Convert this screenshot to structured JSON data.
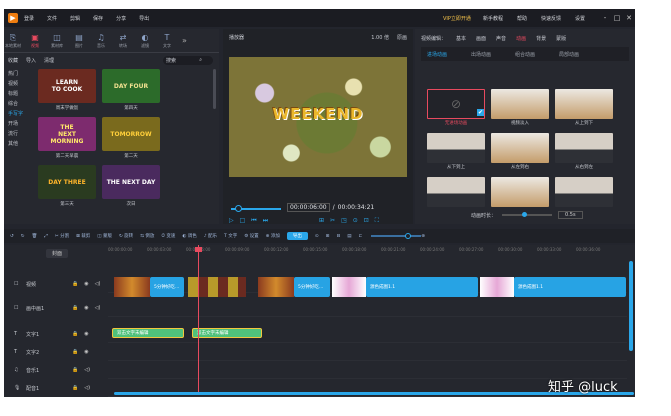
{
  "titlebar": {
    "menu": [
      "登录",
      "文件",
      "剪辑",
      "保存",
      "分享",
      "导出"
    ],
    "vip": "VIP立即开通",
    "right_links": [
      "新手教程",
      "帮助",
      "快速反馈",
      "设置"
    ],
    "window_controls": [
      "-",
      "□",
      "✕"
    ]
  },
  "resources": {
    "tabs": [
      {
        "label": "本地素材",
        "icon": "folder-icon",
        "glyph": "⎘"
      },
      {
        "label": "视频",
        "icon": "video-icon",
        "glyph": "▣",
        "active": true
      },
      {
        "label": "素材库",
        "icon": "library-icon",
        "glyph": "◫"
      },
      {
        "label": "图片",
        "icon": "image-icon",
        "glyph": "▤"
      },
      {
        "label": "音乐",
        "icon": "music-icon",
        "glyph": "♫"
      },
      {
        "label": "转场",
        "icon": "transition-icon",
        "glyph": "⇄"
      },
      {
        "label": "滤镜",
        "icon": "filter-icon",
        "glyph": "◐"
      },
      {
        "label": "文字",
        "icon": "text-icon",
        "glyph": "T"
      }
    ],
    "sub": [
      "收藏",
      "导入",
      "清理"
    ],
    "search_placeholder": "搜索",
    "categories": [
      "热门",
      "视频",
      "标题",
      "综合",
      "手写字",
      "开场",
      "流行",
      "其他"
    ],
    "active_category": 4,
    "thumbnails": [
      {
        "thumb_text": "LEARN\nTO COOK",
        "caption": "周末学做饭"
      },
      {
        "thumb_text": "DAY FOUR",
        "caption": "第四天"
      },
      {
        "thumb_text": "THE\nNEXT\nMORNING",
        "caption": "第二天早晨"
      },
      {
        "thumb_text": "TOMORROW",
        "caption": "第二天"
      },
      {
        "thumb_text": "DAY THREE",
        "caption": "第三天"
      },
      {
        "thumb_text": "THE NEXT DAY",
        "caption": "次日"
      }
    ]
  },
  "preview": {
    "label": "播放器",
    "zoom": "1.00 倍",
    "quality": "原画",
    "overlay_title": "WEEKEND",
    "current_time": "00:00:06:00",
    "total_time": "00:00:34:21",
    "controls": [
      "▷",
      "□",
      "⏮",
      "⏭"
    ],
    "tools": [
      "⊞",
      "✂",
      "◳",
      "⊙",
      "⊡",
      "⛶"
    ]
  },
  "editor": {
    "label": "视频编辑：",
    "tabs": [
      "基本",
      "画面",
      "声音",
      "动画",
      "背景",
      "蒙版"
    ],
    "active_tab": 3,
    "subtabs": [
      "进场动画",
      "出场动画",
      "组合动画",
      "局部动画"
    ],
    "active_subtab": 0,
    "animations": [
      {
        "caption": "无进场动画",
        "none": true,
        "selected": true
      },
      {
        "caption": "视频淡入"
      },
      {
        "caption": "从上到下"
      },
      {
        "caption": "从下到上",
        "dark": true
      },
      {
        "caption": "从左到右"
      },
      {
        "caption": "从右到左",
        "dark": true
      },
      {
        "caption": "",
        "dark": true
      },
      {
        "caption": ""
      },
      {
        "caption": "",
        "dark": true
      }
    ],
    "duration_label": "动画时长：",
    "duration_value": "0.5s"
  },
  "toolbar": {
    "items": [
      "↺",
      "↻",
      "🗑",
      "⤢",
      "✂ 分割",
      "⊠ 裁剪",
      "◫ 蒙版",
      "↻ 旋转",
      "⇆ 倒放",
      "⏱ 变速",
      "◐ 调色",
      "♪ 配乐",
      "T 文字",
      "⚙ 设置",
      "⊕ 添加"
    ],
    "export_label": "导出"
  },
  "timeline": {
    "settle_label": "封面",
    "ruler": [
      "00:00:00:00",
      "00:00:03:00",
      "00:00:06:00",
      "00:00:09:00",
      "00:00:12:00",
      "00:00:15:00",
      "00:00:18:00",
      "00:00:21:00",
      "00:00:24:00",
      "00:00:27:00",
      "00:00:30:00",
      "00:00:33:00",
      "00:00:36:00"
    ],
    "tracks": [
      {
        "icon": "☐",
        "name": "视频"
      },
      {
        "icon": "☐",
        "name": "画中画1"
      },
      {
        "icon": "T",
        "name": "文字1"
      },
      {
        "icon": "T",
        "name": "文字2"
      },
      {
        "icon": "♫",
        "name": "音乐1"
      },
      {
        "icon": "🎙",
        "name": "配音1"
      }
    ],
    "clips": {
      "video_a": "5分钟好吃…",
      "video_b": "5分钟好吃…",
      "video_c": "源色成图1.1",
      "video_d": "源色成图1.1",
      "text_a": "双击文字未编辑",
      "text_b": "双击文字未编辑"
    }
  },
  "watermark": "知乎 @luck"
}
